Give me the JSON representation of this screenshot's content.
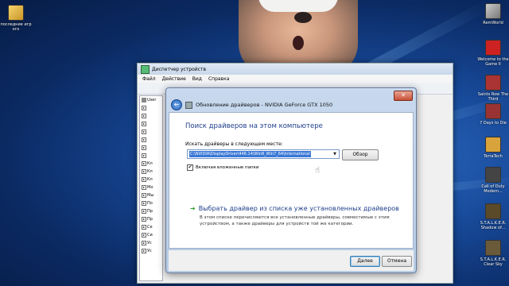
{
  "desktop": {
    "top_left_icon_label": "последние игр ого",
    "right_icons": [
      "RemWorld",
      "Welcome to the Game II",
      "Saints Row The Third",
      "7 Days to Die",
      "TerraTech",
      "Call of Duty Modern...",
      "S.T.A.L.K.E.R. Shadow of...",
      "S.T.A.L.K.E.R. Clear Sky"
    ]
  },
  "device_manager": {
    "title": "Диспетчер устройств",
    "menu": [
      "Файл",
      "Действие",
      "Вид",
      "Справка"
    ],
    "tree_top_label": "User",
    "tree_items": [
      "Кл",
      "Кл",
      "Кл",
      "Мо",
      "Мы",
      "По",
      "Пр",
      "Пр",
      "Се",
      "Си",
      "Ус",
      "Ус"
    ]
  },
  "dialog": {
    "header_title": "Обновление драйверов - NVIDIA GeForce GTX 1050",
    "close_label": "✕",
    "back_icon": "back-arrow-icon",
    "heading": "Поиск драйверов на этом компьютере",
    "search_label": "Искать драйверы в следующем месте:",
    "path_value": "C:\\NVIDIA\\DisplayDriver\\446.14\\Win8_Win7_64\\International",
    "browse_label": "Обзор",
    "include_subfolders_label": "Включая вложенные папки",
    "include_subfolders_checked": true,
    "option_title": "Выбрать драйвер из списка уже установленных драйверов",
    "option_description": "В этом списке перечисляются все установленные драйверы, совместимые с этим устройством, а также драйверы для устройств той же категории.",
    "next_label": "Далее",
    "cancel_label": "Отмена"
  }
}
